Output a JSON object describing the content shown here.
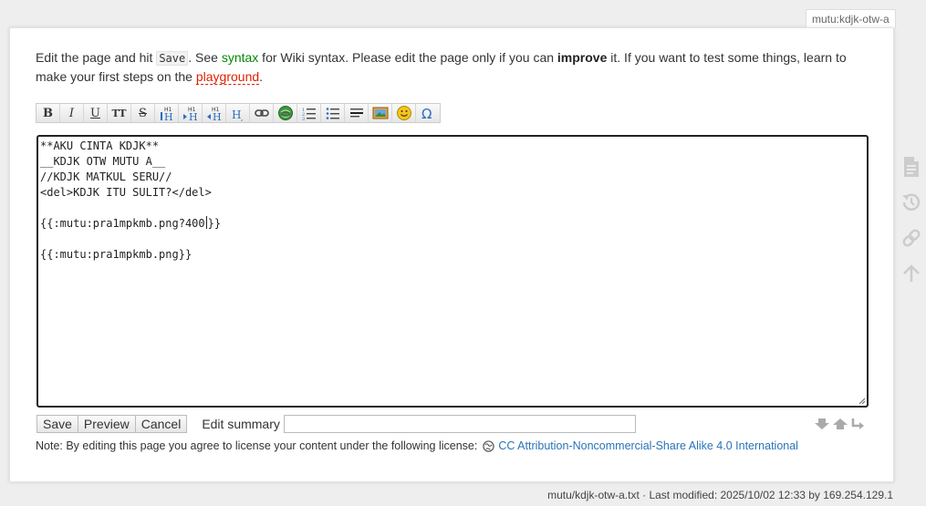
{
  "page_id": "mutu:kdjk-otw-a",
  "intro": {
    "t1": "Edit the page and hit ",
    "save_code": "Save",
    "t2": ". See ",
    "syntax_link": "syntax",
    "t3": " for Wiki syntax. Please edit the page only if you can ",
    "improve": "improve",
    "t4": " it. If you want to test some things, learn to make your first steps on the ",
    "playground_link": "playground",
    "t5": "."
  },
  "toolbar": [
    {
      "name": "bold",
      "icon": "B"
    },
    {
      "name": "italic",
      "icon": "I"
    },
    {
      "name": "underline",
      "icon": "U"
    },
    {
      "name": "monospace",
      "icon": "TT"
    },
    {
      "name": "strikethrough",
      "icon": "S"
    },
    {
      "name": "same-level-headline",
      "icon": "heading-same-icon"
    },
    {
      "name": "lower-headline",
      "icon": "heading-lower-icon"
    },
    {
      "name": "higher-headline",
      "icon": "heading-higher-icon"
    },
    {
      "name": "headline-menu",
      "icon": "heading-menu-icon"
    },
    {
      "name": "link",
      "icon": "link-icon"
    },
    {
      "name": "external-link",
      "icon": "globe-link-icon"
    },
    {
      "name": "ordered-list",
      "icon": "ordered-list-icon"
    },
    {
      "name": "unordered-list",
      "icon": "unordered-list-icon"
    },
    {
      "name": "horizontal-rule",
      "icon": "hr-icon"
    },
    {
      "name": "media",
      "icon": "image-icon"
    },
    {
      "name": "smileys",
      "icon": "smiley-icon"
    },
    {
      "name": "special-chars",
      "icon": "omega-icon"
    }
  ],
  "editor": {
    "lines": [
      "**AKU CINTA KDJK**",
      "__KDJK OTW MUTU A__",
      "//KDJK MATKUL SERU//",
      "<del>KDJK ITU SULIT?</del>",
      "",
      "{{:mutu:pra1mpkmb.png?400",
      "",
      "{{:mutu:pra1mpkmb.png}}"
    ],
    "line6_after_caret": "}}"
  },
  "buttons": {
    "save": "Save",
    "preview": "Preview",
    "cancel": "Cancel"
  },
  "summary": {
    "label": "Edit summary",
    "value": ""
  },
  "license": {
    "text": "Note: By editing this page you agree to license your content under the following license:",
    "link": "CC Attribution-Noncommercial-Share Alike 4.0 International"
  },
  "footer": {
    "text": "mutu/kdjk-otw-a.txt · Last modified: 2025/10/02 12:33 by 169.254.129.1"
  },
  "colors": {
    "wiki_link": "#008800",
    "missing_link": "#dd2200",
    "license_link": "#2b73b7"
  }
}
